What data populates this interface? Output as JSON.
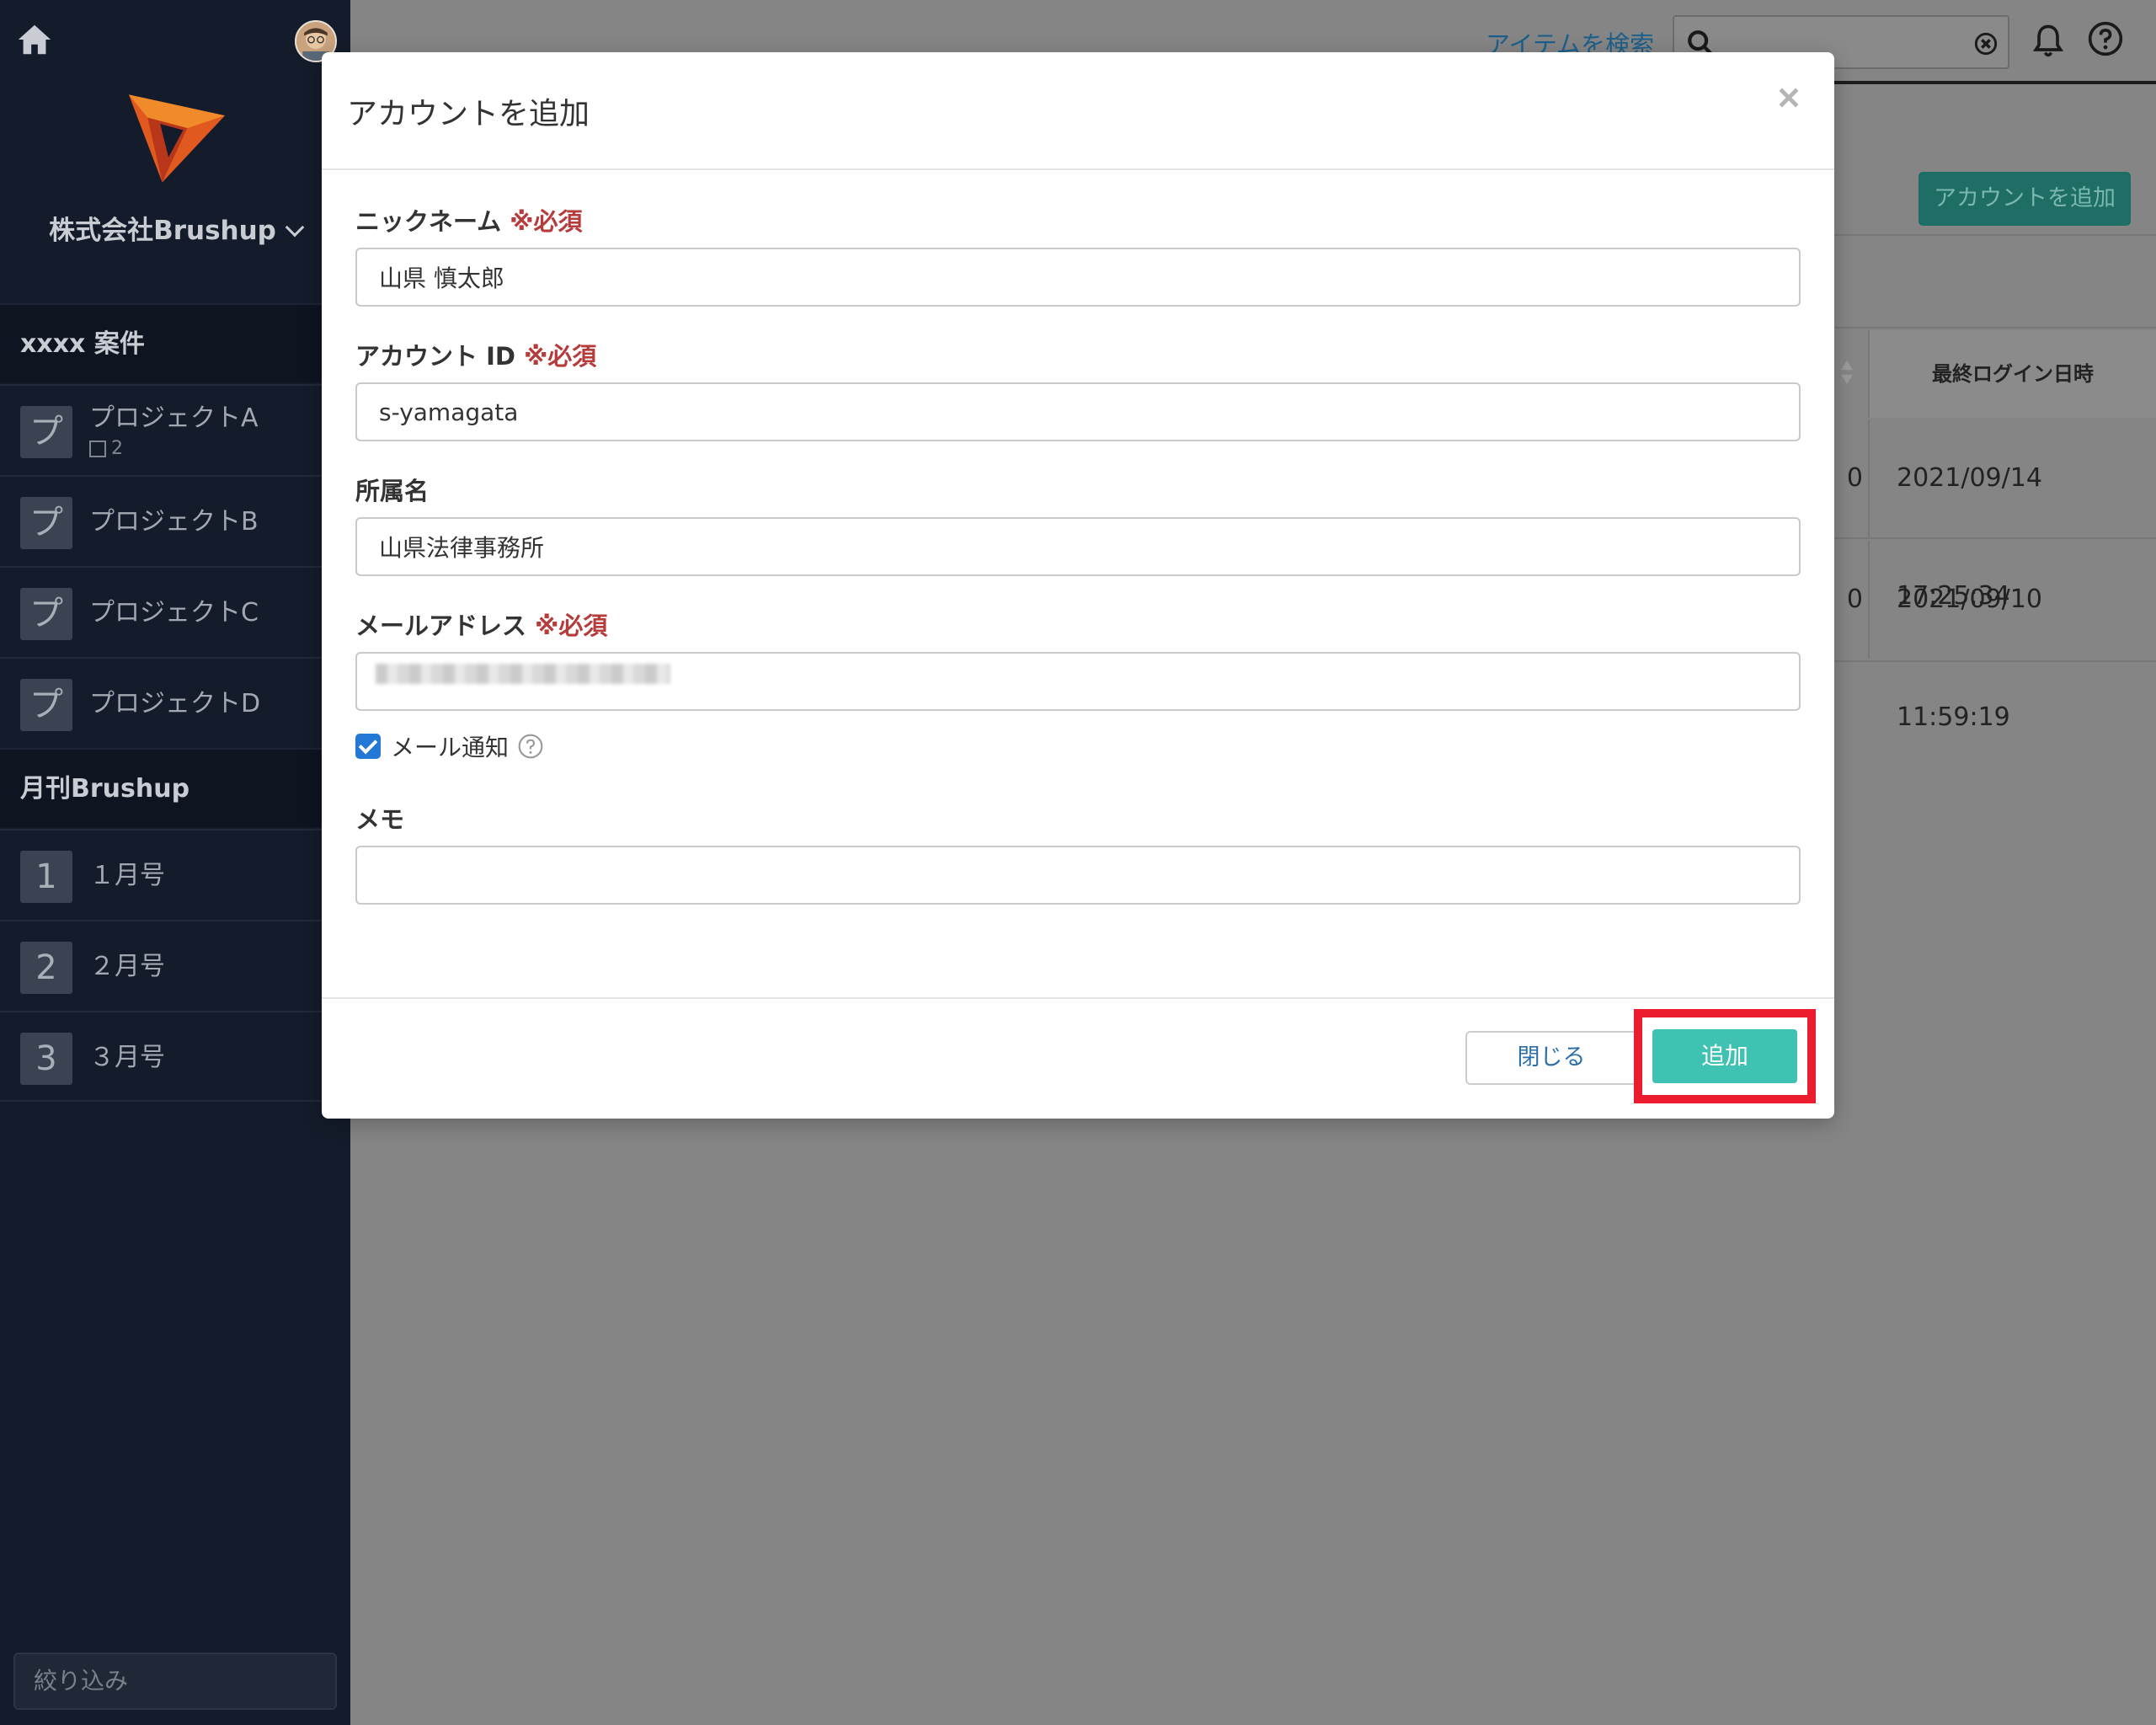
{
  "sidebar": {
    "org_name": "株式会社Brushup",
    "sections": [
      {
        "title": "xxxx 案件",
        "items": [
          {
            "badge": "プ",
            "label": "プロジェクトA",
            "sub_count": "2"
          },
          {
            "badge": "プ",
            "label": "プロジェクトB"
          },
          {
            "badge": "プ",
            "label": "プロジェクトC"
          },
          {
            "badge": "プ",
            "label": "プロジェクトD"
          }
        ]
      },
      {
        "title": "月刊Brushup",
        "items": [
          {
            "badge": "1",
            "label": "１月号"
          },
          {
            "badge": "2",
            "label": "２月号"
          },
          {
            "badge": "3",
            "label": "３月号"
          }
        ]
      }
    ],
    "filter_placeholder": "絞り込み"
  },
  "header": {
    "search_link": "アイテムを検索"
  },
  "background": {
    "add_account_button": "アカウントを追加",
    "table": {
      "last_login_header": "最終ログイン日時",
      "rows": [
        {
          "cut_value": "0",
          "last_login": "2021/09/14 17:25:34"
        },
        {
          "cut_value": "0",
          "last_login": "2021/09/10 11:59:19"
        }
      ]
    }
  },
  "modal": {
    "title": "アカウントを追加",
    "required_mark": "※必須",
    "fields": {
      "nickname": {
        "label": "ニックネーム",
        "value": "山県 慎太郎"
      },
      "account_id": {
        "label": "アカウント ID",
        "value": "s-yamagata"
      },
      "affiliation": {
        "label": "所属名",
        "value": "山県法律事務所"
      },
      "email": {
        "label": "メールアドレス",
        "value": ""
      },
      "memo": {
        "label": "メモ",
        "value": ""
      }
    },
    "mail_notify_label": "メール通知",
    "close_button": "閉じる",
    "add_button": "追加"
  },
  "colors": {
    "sidebar_bg": "#141c2b",
    "accent": "#3fc2b1",
    "required": "#b63b3b",
    "highlight": "#ea1c2d"
  }
}
